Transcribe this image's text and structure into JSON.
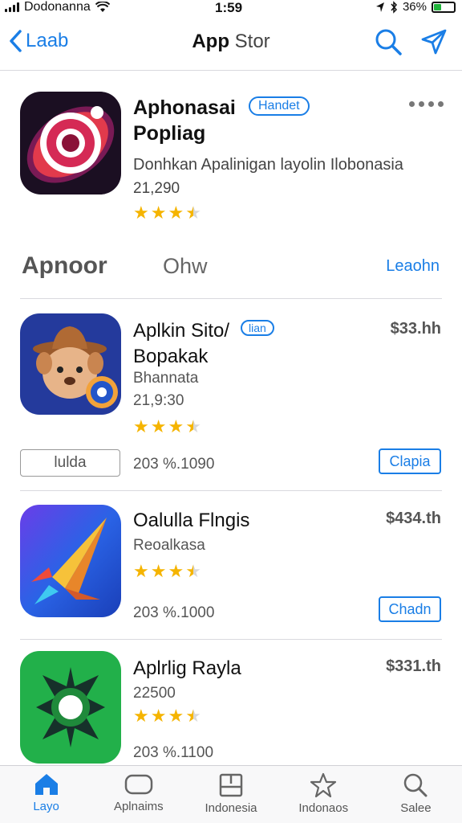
{
  "status_bar": {
    "carrier": "Dodonanna",
    "time": "1:59",
    "battery_text": "36%",
    "battery_level": 0.36
  },
  "nav": {
    "back_label": "Laab",
    "title_bold": "App",
    "title_light": "Stor"
  },
  "featured": {
    "name_line1": "Aphonasai",
    "name_line2": "Popliag",
    "tag": "Handet",
    "description": "Donhkan Apalinigan layolin Ilobonasia",
    "count": "21,290",
    "rating": 3.5
  },
  "section": {
    "tab1": "Apnoor",
    "tab2": "Ohw",
    "action": "Leaohn"
  },
  "apps": [
    {
      "title_line1": "Aplkin Sito/",
      "title_line2": "Bopakak",
      "tag": "lian",
      "subtitle": "Bhannata",
      "count": "21,9:30",
      "price": "$33.hh",
      "rating": 3.5,
      "stat": "203 %.1090",
      "left_button": "lulda",
      "right_button": "Clapia"
    },
    {
      "title_line1": "Oalulla Flngis",
      "subtitle": "Reoalkasa",
      "price": "$434.th",
      "rating": 3.5,
      "stat": "203 %.1000",
      "right_button": "Chadn"
    },
    {
      "title_line1": "Aplrlig Rayla",
      "count": "22500",
      "price": "$331.th",
      "rating": 3.5,
      "stat": "203 %.1100"
    }
  ],
  "tabs": [
    {
      "label": "Layo",
      "icon": "home-icon",
      "active": true
    },
    {
      "label": "Aplnaims",
      "icon": "apps-icon",
      "active": false
    },
    {
      "label": "Indonesia",
      "icon": "box-icon",
      "active": false
    },
    {
      "label": "Indonaos",
      "icon": "star-icon",
      "active": false
    },
    {
      "label": "Salee",
      "icon": "search-icon",
      "active": false
    }
  ],
  "colors": {
    "accent": "#1a7ee6",
    "star": "#f5b400"
  }
}
